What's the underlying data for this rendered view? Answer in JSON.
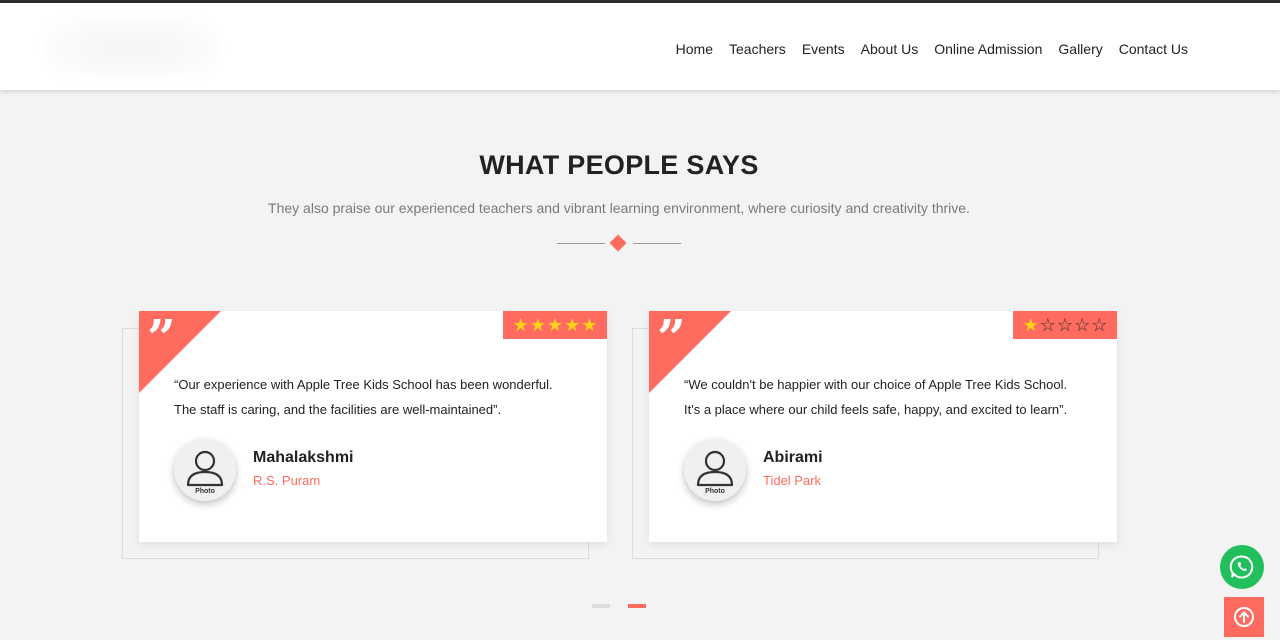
{
  "nav": {
    "items": [
      "Home",
      "Teachers",
      "Events",
      "About Us",
      "Online Admission",
      "Gallery",
      "Contact Us"
    ]
  },
  "section": {
    "title": "WHAT PEOPLE SAYS",
    "subtitle": "They also praise our experienced teachers and vibrant learning environment, where curiosity and creativity thrive."
  },
  "testimonials": [
    {
      "quote_mark": "”",
      "rating": 5,
      "rating_max": 5,
      "quote_line1": "“Our experience with Apple Tree Kids School has been wonderful.",
      "quote_line2": "The staff is caring, and the facilities are well-maintained”.",
      "avatar_label": "Photo",
      "name": "Mahalakshmi",
      "location": "R.S. Puram"
    },
    {
      "quote_mark": "”",
      "rating": 1,
      "rating_max": 5,
      "quote_line1": "“We couldn't be happier with our choice of Apple Tree Kids School.",
      "quote_line2": "It's a place where our child feels safe, happy, and excited to learn”.",
      "avatar_label": "Photo",
      "name": "Abirami",
      "location": "Tidel Park"
    }
  ],
  "carousel": {
    "pages": 2,
    "active": 2
  },
  "colors": {
    "accent": "#ff6b5e",
    "star": "#ffd21a",
    "whatsapp": "#21c05c"
  },
  "icons": {
    "whatsapp": "whatsapp-icon",
    "back_to_top": "arrow-up-circle-icon",
    "avatar": "user-icon"
  }
}
